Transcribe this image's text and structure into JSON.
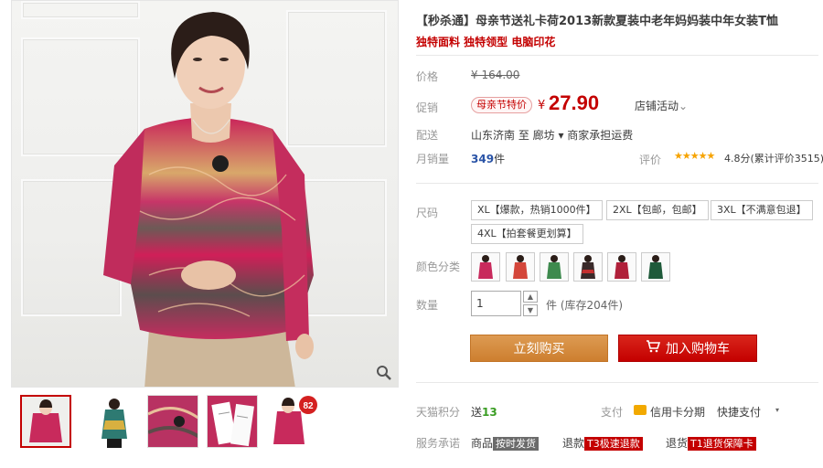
{
  "product": {
    "title": "【秒杀通】母亲节送礼卡荷2013新款夏装中老年妈妈装中年女装T恤",
    "subtitle": "独特面料 独特领型 电脑印花"
  },
  "price": {
    "label": "价格",
    "original": "¥ 164.00",
    "promo_label": "促销",
    "promo_badge": "母亲节特价",
    "yen": "¥",
    "sale": "27.90",
    "shop_activity": "店铺活动",
    "shop_activity_caret": "⌄"
  },
  "delivery": {
    "label": "配送",
    "text": "山东济南 至 廊坊 ▾ 商家承担运费"
  },
  "sales": {
    "label": "月销量",
    "count": "349",
    "unit": "件",
    "rating_label": "评价",
    "stars": "★★★★★",
    "rating_text": "4.8分(累计评价3515)"
  },
  "options": {
    "size_label": "尺码",
    "sizes": [
      "XL【爆款，热销1000件】",
      "2XL【包邮，包邮】",
      "3XL【不满意包退】",
      "4XL【拍套餐更划算】"
    ],
    "color_label": "颜色分类",
    "quantity_label": "数量",
    "quantity": "1",
    "stock": "件 (库存204件)"
  },
  "actions": {
    "buy_now": "立刻购买",
    "add_cart": "加入购物车"
  },
  "services": {
    "points_label": "天猫积分",
    "points_text": "送",
    "points_value": "13",
    "pay_label": "支付",
    "credit_pay": "信用卡分期",
    "quick_pay": "快捷支付",
    "quick_caret": "▾",
    "guarantee_label": "服务承诺",
    "g1_pre": "商品",
    "g1_tag": "按时发货",
    "g2_pre": "退款",
    "g2_tag": "T3极速退款",
    "g3_pre": "退货",
    "g3_tag": "T1退货保障卡"
  },
  "thumbs": {
    "discount_badge": "82"
  },
  "colors": {
    "accent": "#c40000",
    "buy_button": "#d58a3a",
    "cart_button": "#c40000",
    "link_blue": "#2953a6",
    "points_green": "#3a9d23",
    "star_gold": "#f6a300"
  }
}
